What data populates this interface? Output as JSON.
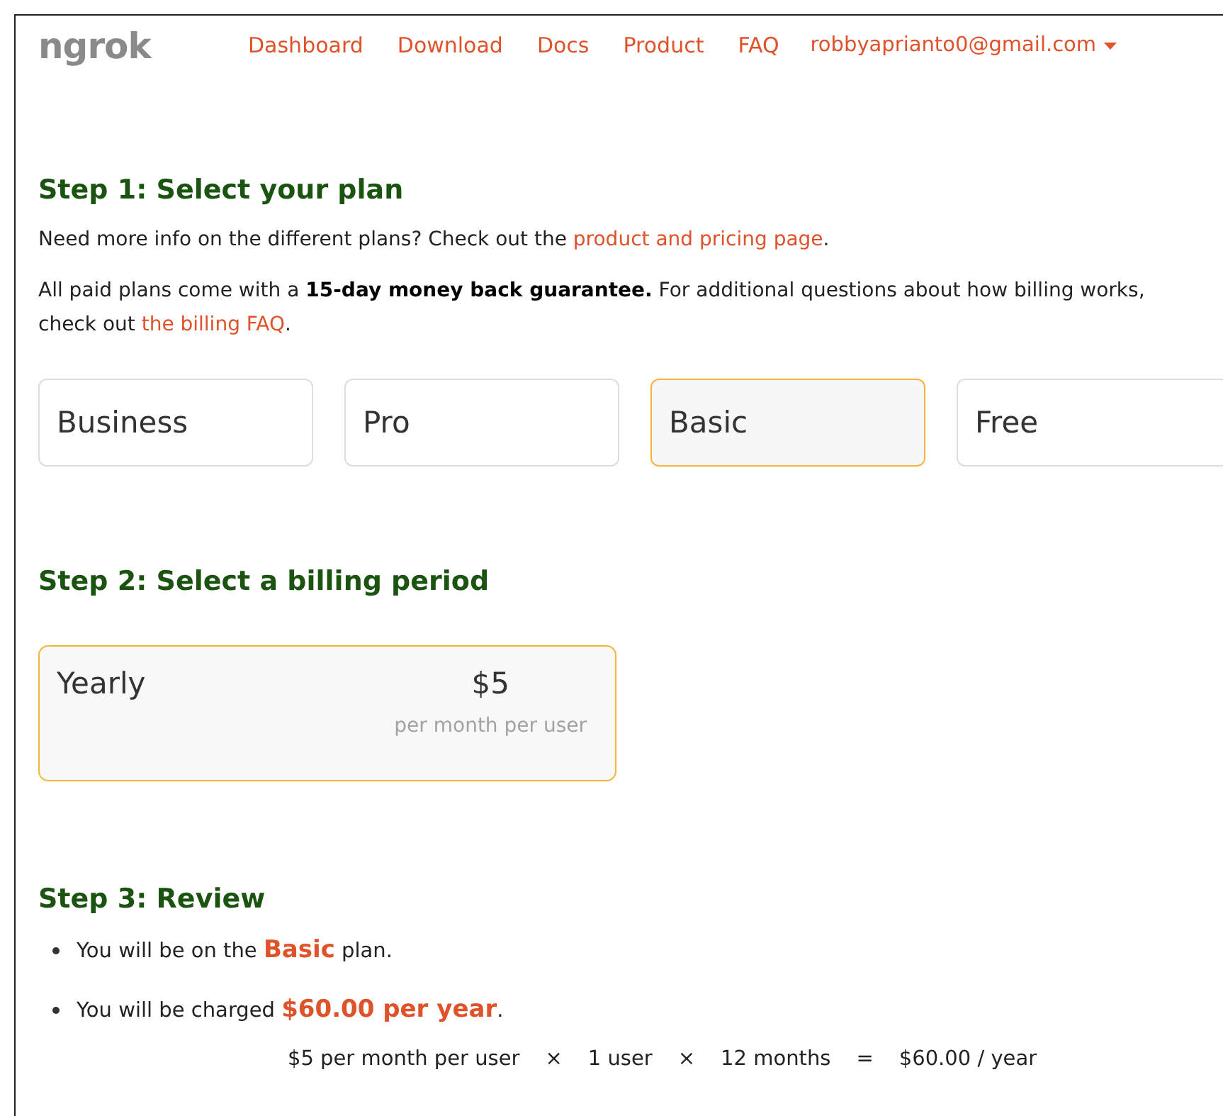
{
  "nav": {
    "logo": "ngrok",
    "links": [
      "Dashboard",
      "Download",
      "Docs",
      "Product",
      "FAQ"
    ],
    "account": "robbyaprianto0@gmail.com"
  },
  "step1": {
    "title": "Step 1: Select your plan",
    "paragraphs": [
      {
        "before": "Need more info on the different plans? Check out the ",
        "link": "product and pricing page",
        "after": "."
      },
      {
        "before": "All paid plans come with a **15-day money back guarantee.** For additional questions about how billing works, check out ",
        "link": "the billing FAQ",
        "after": "."
      }
    ],
    "plans": [
      {
        "label": "Business",
        "selected": false
      },
      {
        "label": "Pro",
        "selected": false
      },
      {
        "label": "Basic",
        "selected": true
      },
      {
        "label": "Free",
        "selected": false
      }
    ]
  },
  "step2": {
    "title": "Step 2: Select a billing period",
    "periods": [
      {
        "label": "Yearly",
        "price": "$5",
        "unit": "per month per user",
        "selected": true
      }
    ]
  },
  "step3": {
    "title": "Step 3: Review",
    "items": [
      "You will be on the **Basic** plan.",
      "You will be charged **$60.00 per year**."
    ],
    "calculation": [
      "$5 per month per user",
      "×",
      "1 user",
      "×",
      "12 months",
      "=",
      "$60.00 / year"
    ]
  }
}
